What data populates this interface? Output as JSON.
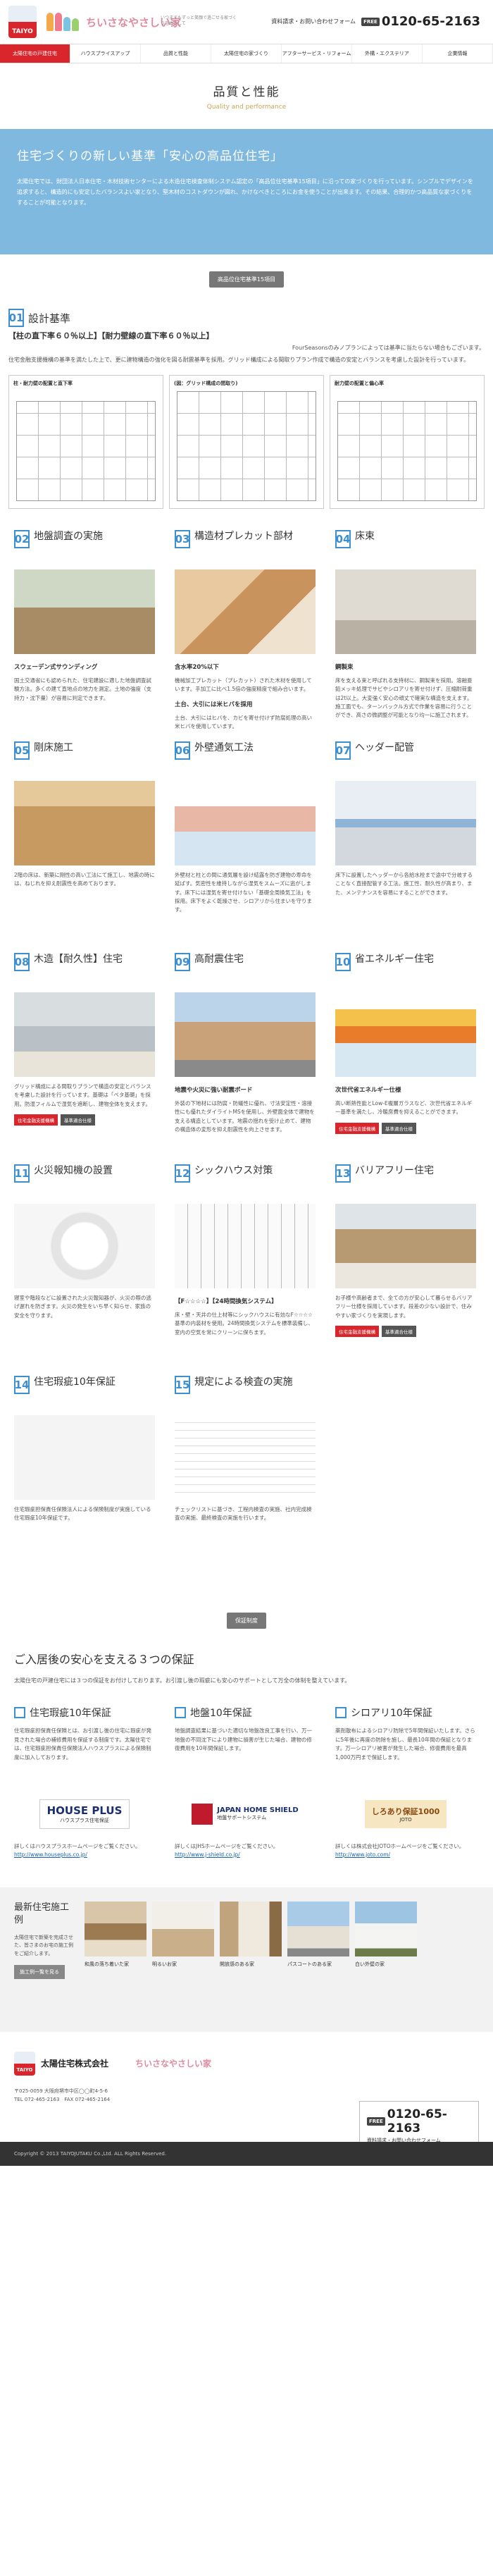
{
  "header": {
    "logo_text": "TAIYO",
    "brand": "ちいさなやさしい家",
    "tagline": "いつまでもずっと笑顔で過ごせる家づくりをめざして",
    "contact_link": "資料請求・お問い合わせフォーム",
    "freedial": "FREE",
    "tel": "0120-65-2163"
  },
  "nav": [
    "太陽住宅の戸建住宅",
    "ハウスプライスアップ",
    "品質と性能",
    "太陽住宅の家づくり",
    "アフターサービス・リフォーム",
    "外構・エクステリア",
    "企業情報"
  ],
  "page": {
    "title": "品質と性能",
    "subtitle": "Quality and performance"
  },
  "hero": {
    "title": "住宅づくりの新しい基準「安心の高品位住宅」",
    "text": "太陽住宅では、財団法人日本住宅・木材技術センターによる木造住宅検査体制システム認定の「高品位住宅基準15項目」に沿っての家づくりを行っています。シンプルでデザインを追求すると、構造的にも安定したバランスよい家となり、堅木材のコストダウンが図れ、かけなべきところにお金を使うことが出来ます。その結果、合理的かつ高品質な家づくりをすることが可能となります。"
  },
  "section_label": "高品位住宅基準15項目",
  "item1": {
    "num": "01",
    "title": "設計基準",
    "sub": "【柱の直下率６０％以上】【耐力壁線の直下率６０％以上】",
    "note": "FourSeasonsのみノプランによっては基準に当たらない場合もございます。",
    "desc": "住宅金融支援機構の基準を満たした上で、更に建物構造の強化を図る耐震基準を採用。グリッド構成による間取りプラン作成で構造の安定とバランスを考慮した設計を行っています。",
    "panels": [
      "柱・耐力壁の配置と直下率",
      "(図：グリッド構成の間取り)",
      "耐力壁の配置と偏心率"
    ]
  },
  "items": [
    {
      "num": "02",
      "title": "地盤調査の実施",
      "cap": "スウェーデン式サウンディング",
      "desc": "国土交通省にも認められた、住宅建設に適した地盤調査試験方法。多くの建て直地点の地力を測定。土地の強度（支持力・沈下量）が容易に判定できます。",
      "badges": []
    },
    {
      "num": "03",
      "title": "構造材プレカット部材",
      "cap": "含水率20%以下",
      "desc": "機械加工プレカット（プレカット）された木材を使用しています。手加工に比べ1.5倍の強度精度で組み合います。",
      "cap2": "土台、大引には米ヒバを採用",
      "desc2": "土台、大引にはヒバを、カビを寄せ付けず防腐処理の高い米ヒバを使用しています。",
      "badges": []
    },
    {
      "num": "04",
      "title": "床束",
      "cap": "鋼製束",
      "desc": "床を支える束と呼ばれる支持材に、鋼製束を採用。溶融亜鉛メッキ処理でサビやシロアリを寄せ付けず、圧縮耐荷重は2t以上。大変強く安心の頑丈で確実な構造を支えます。施工面でも、ターンバックル方式で作業を容易に行うことができ、高さの微調整が可能となり均一に施工されます。",
      "badges": []
    },
    {
      "num": "05",
      "title": "剛床施工",
      "cap": "",
      "desc": "2階の床は、新築に剛性の高い工法にて施工し、地震の時には、ねじれを抑え耐震性を高めております。",
      "badges": []
    },
    {
      "num": "06",
      "title": "外壁通気工法",
      "cap": "",
      "desc": "外壁材と柱との間に通気層を設け結露を防ぎ建物の寿命を延ばす。気密性を維持しながら湿気をスムーズに逃がします。床下には湿気を寄せ付けない「基礎全周換気工法」を採用。床下をよく乾燥させ、シロアリから住まいを守ります。",
      "badges": []
    },
    {
      "num": "07",
      "title": "ヘッダー配管",
      "cap": "",
      "desc": "床下に設置したヘッダーから各給水栓まで途中で分岐することなく直接配管する工法。施工性、耐久性が高まり、また、メンテナンスを容易にすることができます。",
      "badges": []
    },
    {
      "num": "08",
      "title": "木造【耐久性】住宅",
      "cap": "",
      "desc": "グリッド構成による間取りプランで構造の安定とバランスを考慮した設計を行っています。基礎は「ベタ基礎」を採用。防湿フィルムで湿気を遮断し、建物全体を支えます。",
      "badges": [
        "住宅金融支援機構",
        "基準適合仕様"
      ]
    },
    {
      "num": "09",
      "title": "高耐震住宅",
      "cap": "地震や火災に強い耐震ボード",
      "desc": "外装の下地材には防腐・防蟻性に優れ、寸法安定性・溶接性にも優れたダイライトMSを使用し、外壁面全体で建物を支える構造としています。地震の揺れを受け止めて、建物の構造体の変形を抑え耐震性を向上させます。",
      "badges": []
    },
    {
      "num": "10",
      "title": "省エネルギー住宅",
      "cap": "次世代省エネルギー仕様",
      "desc": "高い断熱性能とLow-E複層ガラスなど、次世代省エネルギー基準を満たし、冷暖房費を抑えることができます。",
      "badges": [
        "住宅金融支援機構",
        "基準適合仕様"
      ]
    },
    {
      "num": "11",
      "title": "火災報知機の設置",
      "cap": "",
      "desc": "寝室や階段などに設置された火災報知器が、火災の際の逃げ遅れを防ぎます。火災の発生をいち早く知らせ、家族の安全を守ります。",
      "badges": []
    },
    {
      "num": "12",
      "title": "シックハウス対策",
      "cap": "【F☆☆☆☆】【24時間換気システム】",
      "desc": "床・壁・天井の仕上材等にシックハウスに有効なF☆☆☆☆基準の内装材を使用。24時間換気システムを標準装備し、室内の空気を常にクリーンに保ちます。",
      "badges": []
    },
    {
      "num": "13",
      "title": "バリアフリー住宅",
      "cap": "",
      "desc": "お子様や高齢者まで、全ての方が安心して暮らせるバリアフリー仕様を採用しています。段差の少ない設計で、住みやすい家づくりを実現します。",
      "badges": [
        "住宅金融支援機構",
        "基準適合仕様"
      ]
    },
    {
      "num": "14",
      "title": "住宅瑕疵10年保証",
      "cap": "",
      "desc": "住宅瑕疵担保責任保険法人による保険制度が実施している住宅瑕疵10年保証です。",
      "badges": []
    },
    {
      "num": "15",
      "title": "規定による検査の実施",
      "cap": "",
      "desc": "チェックリストに基づき、工程内検査の実施、社内完成検査の実施、最終検査の実施を行います。",
      "badges": []
    }
  ],
  "warranty": {
    "label": "保証制度",
    "title": "ご入居後の安心を支える３つの保証",
    "intro": "太陽住宅の戸建住宅には３つの保証をお付けしております。お引渡し後の瑕疵にも安心のサポートとして万全の体制を整えています。",
    "items": [
      {
        "title": "住宅瑕疵10年保証",
        "desc": "住宅瑕疵担保責任保険とは、お引渡し後の住宅に瑕疵が発見された場合の補修費用を保証する制度です。太陽住宅では、住宅瑕疵担保責任保険法人ハウスプラスによる保険制度に加入しております。",
        "logo": "HOUSE PLUS",
        "logo2": "ハウスプラス住宅保証",
        "link": "詳しくはハウスプラスホームページをご覧ください。",
        "url": "http://www.houseplus.co.jp/"
      },
      {
        "title": "地盤10年保証",
        "desc": "地盤調査結果に基づいた適切な地盤改良工事を行い、万一地盤の不同沈下により建物に損害が生じた場合、建物の修復費用を10年間保証します。",
        "logo": "JAPAN HOME SHIELD",
        "logo2": "地盤サポートシステム",
        "link": "詳しくはJHSホームページをご覧ください。",
        "url": "http://www.j-shield.co.jp/"
      },
      {
        "title": "シロアリ10年保証",
        "desc": "薬剤散布によるシロアリ防除で5年間保証いたします。さらに5年後に再度の防除を施し、最長10年間の保証となります。万一シロアリ被害が発生した場合、修復費用を最高1,000万円まで保証します。",
        "logo": "しろあり保証1000",
        "logo2": "JOTO",
        "link": "詳しくは株式会社JOTOホームページをご覧ください。",
        "url": "http://www.joto.com/"
      }
    ]
  },
  "news": {
    "title": "最新住宅施工例",
    "desc": "太陽住宅で新築を完成させた、皆さまのお宅の施工例をご紹介します。",
    "button": "施工例一覧を見る",
    "thumbs": [
      "和風の落ち着いた家",
      "明るいお家",
      "開放感のある家",
      "パスコートのある家",
      "白い外壁の家"
    ]
  },
  "footer": {
    "name": "太陽住宅株式会社",
    "address": "〒025-0059 大阪府堺市中区◯◯町4-5-6",
    "tel": "TEL 072-465-2163　FAX 072-465-2164",
    "contact": "資料請求・お問い合わせフォーム",
    "copyright": "Copyright © 2013 TAIYOJUTAKU Co.,Ltd. ALL Rights Reserved."
  },
  "colors": {
    "accent": "#d8262c",
    "hero": "#7fb9e0",
    "number": "#3d8fd0"
  }
}
